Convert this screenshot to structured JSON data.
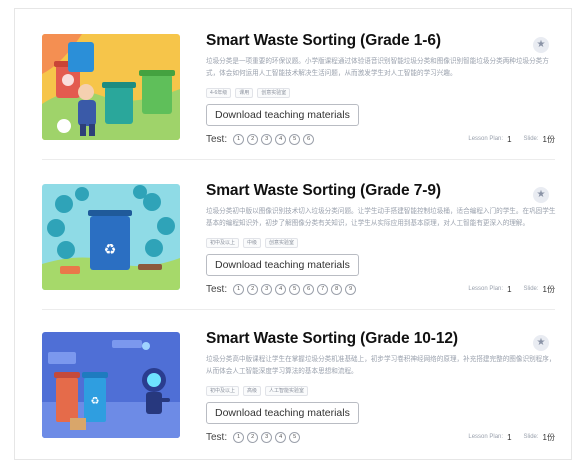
{
  "courses": [
    {
      "title": "Smart Waste Sorting (Grade 1-6)",
      "description": "垃圾分类是一项重要的环保议题。小学版课程通过体验语音识别智能垃圾分类和图像识别智能垃圾分类两种垃圾分类方式，体会如何运用人工智能技术解决生活问题，从而激发学生对人工智能的学习兴趣。",
      "tags": [
        "4-6年级",
        "课用",
        "创意实验室"
      ],
      "download_label": "Download teaching materials",
      "test_label": "Test:",
      "tests": [
        "1",
        "2",
        "3",
        "4",
        "5",
        "6"
      ],
      "lesson_plan_label": "Lesson Plan:",
      "lesson_plan_value": "1",
      "slide_label": "Slide:",
      "slide_value": "1份"
    },
    {
      "title": "Smart Waste Sorting (Grade 7-9)",
      "description": "垃圾分类初中版以图像识别技术切入垃圾分类问题。让学生动手搭建智能控制垃圾桶，适合编程入门的学生。在巩固学生基本的编程知识外，初步了解图像分类有关知识，让学生从实际应用到基本原理，对人工智能有更深入的理解。",
      "tags": [
        "初中及以上",
        "中级",
        "创意实验室"
      ],
      "download_label": "Download teaching materials",
      "test_label": "Test:",
      "tests": [
        "1",
        "2",
        "3",
        "4",
        "5",
        "6",
        "7",
        "8",
        "9"
      ],
      "lesson_plan_label": "Lesson Plan:",
      "lesson_plan_value": "1",
      "slide_label": "Slide:",
      "slide_value": "1份"
    },
    {
      "title": "Smart Waste Sorting (Grade 10-12)",
      "description": "垃圾分类高中版课程让学生在掌握垃圾分类机准基础上，初步学习卷积神经网络的原理，补充搭建完整的图像识别程序，从而体会人工智能深度学习算法的基本思想和流程。",
      "tags": [
        "初中及以上",
        "高级",
        "人工智能实验室"
      ],
      "download_label": "Download teaching materials",
      "test_label": "Test:",
      "tests": [
        "1",
        "2",
        "3",
        "4",
        "5"
      ],
      "lesson_plan_label": "Lesson Plan:",
      "lesson_plan_value": "1",
      "slide_label": "Slide:",
      "slide_value": "1份"
    }
  ],
  "star_icon": "star-icon",
  "colors": {
    "title": "#111111",
    "description": "#9aa1ad",
    "button_border": "#b9bcc3",
    "star_bg": "#e9ecf2"
  }
}
